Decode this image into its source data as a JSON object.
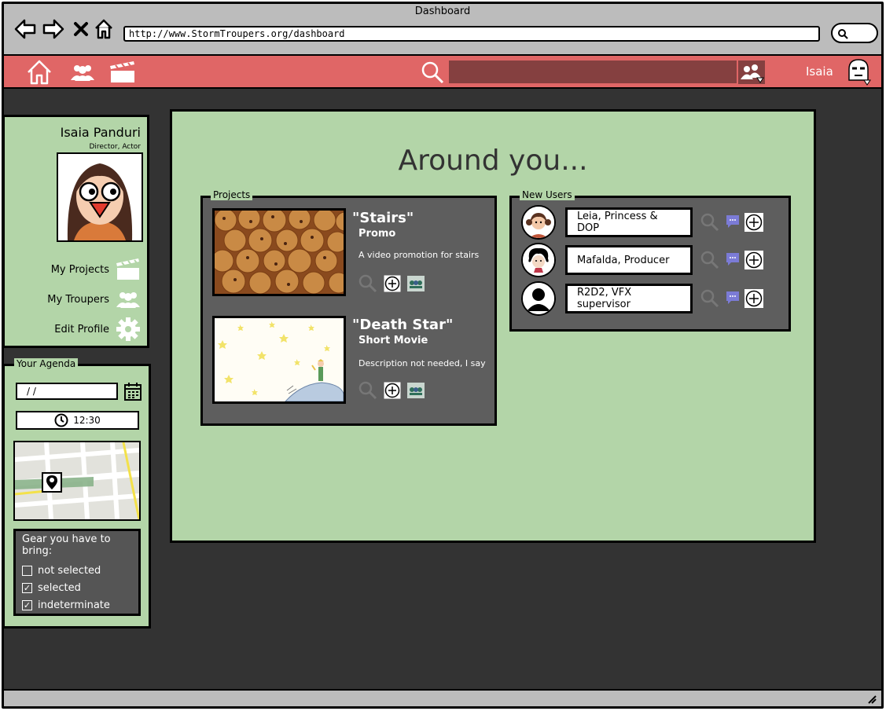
{
  "window": {
    "title": "Dashboard",
    "url": "http://www.StormTroupers.org/dashboard"
  },
  "appbar": {
    "user_name": "Isaia"
  },
  "profile": {
    "name": "Isaia Panduri",
    "roles": "Director,  Actor",
    "menu": [
      {
        "label": "My Projects",
        "icon": "clapperboard-icon"
      },
      {
        "label": "My Troupers",
        "icon": "users-icon"
      },
      {
        "label": "Edit Profile",
        "icon": "gear-icon"
      }
    ]
  },
  "agenda": {
    "title": "Your Agenda",
    "date_value": "/ /",
    "time_value": "12:30",
    "gear": {
      "title": "Gear you have to bring:",
      "items": [
        {
          "label": "not selected",
          "state": "unchecked"
        },
        {
          "label": "selected",
          "state": "checked"
        },
        {
          "label": "indeterminate",
          "state": "checked"
        }
      ]
    }
  },
  "main": {
    "title": "Around you...",
    "projects": {
      "label": "Projects",
      "items": [
        {
          "title": "\"Stairs\"",
          "subtitle": "Promo",
          "description": "A video promotion for stairs"
        },
        {
          "title": "\"Death Star\"",
          "subtitle": "Short Movie",
          "description": "Description not needed, I say"
        }
      ]
    },
    "new_users": {
      "label": "New Users",
      "items": [
        {
          "label": "Leia, Princess & DOP"
        },
        {
          "label": "Mafalda, Producer"
        },
        {
          "label": "R2D2, VFX supervisor"
        }
      ]
    }
  },
  "colors": {
    "appbar": "#e06666",
    "panel": "#b3d5a8",
    "dark": "#333333",
    "group": "#5e5e5e",
    "chat": "#7b7bd6"
  }
}
